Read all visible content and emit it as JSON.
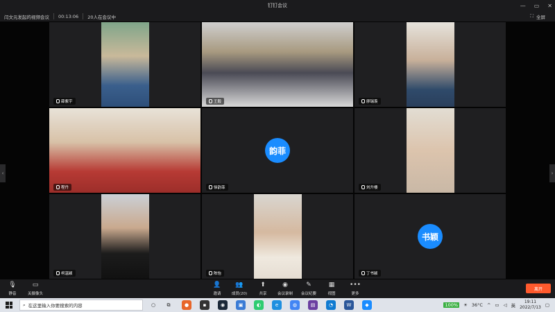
{
  "window": {
    "title": "钉钉会议",
    "fullscreen_label": "全屏"
  },
  "meeting": {
    "name": "闫文元发起的视频会议",
    "elapsed": "00:13:06",
    "participant_status": "20人在会议中"
  },
  "participants": [
    {
      "name": "薛紫宇",
      "video": true
    },
    {
      "name": "王毅",
      "video": true
    },
    {
      "name": "廖瑞羡",
      "video": true
    },
    {
      "name": "程丹",
      "video": true
    },
    {
      "name": "徐韵菲",
      "video": false,
      "avatar_text": "韵菲"
    },
    {
      "name": "刘升楼",
      "video": true
    },
    {
      "name": "柯温颖",
      "video": true
    },
    {
      "name": "陈怡",
      "video": true
    },
    {
      "name": "丁书颖",
      "video": false,
      "avatar_text": "书颖"
    }
  ],
  "toolbar": {
    "mute": "静音",
    "camera": "关摄像头",
    "invite": "邀请",
    "members": "成员(20)",
    "share": "共享",
    "record": "会议录制",
    "minutes": "会议纪要",
    "view": "视图",
    "more": "更多",
    "leave": "离开"
  },
  "taskbar": {
    "search_placeholder": "在这里输入你要搜索的内容",
    "battery": "100%",
    "temperature": "36°C",
    "ime": "英",
    "time": "19:11",
    "date": "2022/7/13"
  },
  "colors": {
    "accent": "#1a8cff",
    "leave": "#ff5a2d"
  }
}
